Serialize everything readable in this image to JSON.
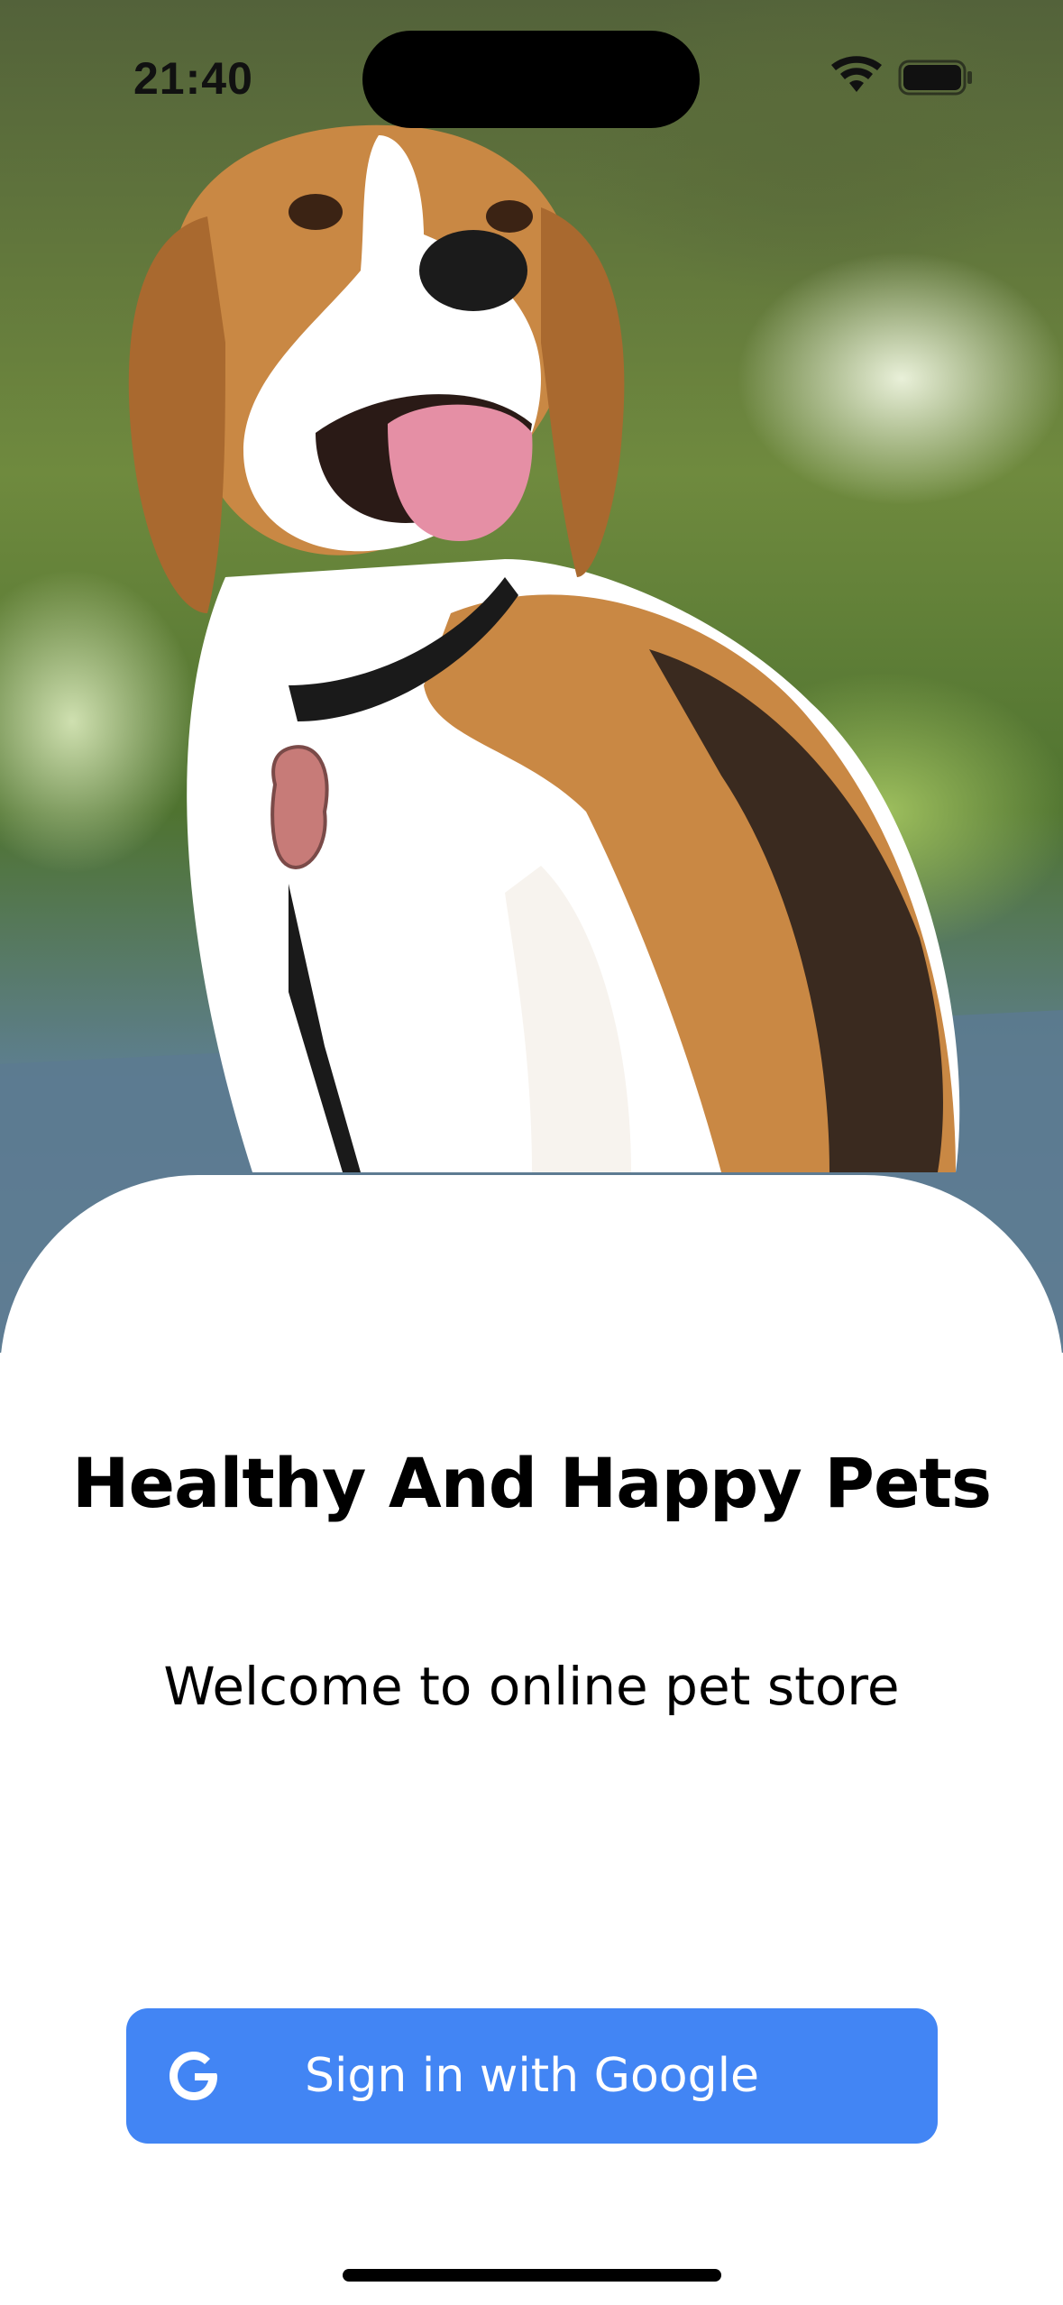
{
  "status_bar": {
    "time": "21:40",
    "wifi_icon": "wifi-icon",
    "battery_icon": "battery-icon"
  },
  "hero": {
    "image": "beagle-dog-photo"
  },
  "welcome": {
    "title": "Healthy And Happy Pets",
    "subtitle": "Welcome to online pet store"
  },
  "sign_in": {
    "label": "Sign in with Google",
    "icon": "google-icon",
    "color": "#4285f4"
  }
}
